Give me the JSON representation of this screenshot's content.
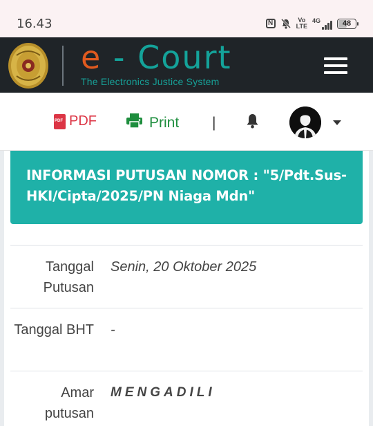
{
  "status_bar": {
    "time": "16.43",
    "volte_line1": "Vo",
    "volte_line2": "LTE",
    "network": "4G",
    "battery": "48"
  },
  "header": {
    "brand_e": "e",
    "brand_rest": " - Court",
    "tagline": "The Electronics Justice System"
  },
  "toolbar": {
    "pdf_label": "PDF",
    "print_label": "Print",
    "separator": "|"
  },
  "banner": {
    "title": "INFORMASI PUTUSAN NOMOR : \"5/Pdt.Sus-HKI/Cipta/2025/PN Niaga Mdn\""
  },
  "details": [
    {
      "label": "Tanggal Putusan",
      "value": "Senin, 20 Oktober 2025"
    },
    {
      "label": "Tanggal BHT",
      "value": "-"
    },
    {
      "label": "Amar putusan",
      "value": "MENGADILI"
    }
  ],
  "colors": {
    "header_bg": "#1f2428",
    "brand_orange": "#e05a1f",
    "brand_teal": "#14a39a",
    "banner_teal": "#1fb1a8",
    "pdf_red": "#dc3545",
    "print_green": "#1e8e3e"
  },
  "icons": [
    "nfc-icon",
    "mute-bell-icon",
    "signal-icon",
    "battery-icon",
    "court-emblem-logo",
    "hamburger-menu-icon",
    "pdf-file-icon",
    "printer-icon",
    "bell-icon",
    "user-avatar",
    "caret-down-icon"
  ]
}
